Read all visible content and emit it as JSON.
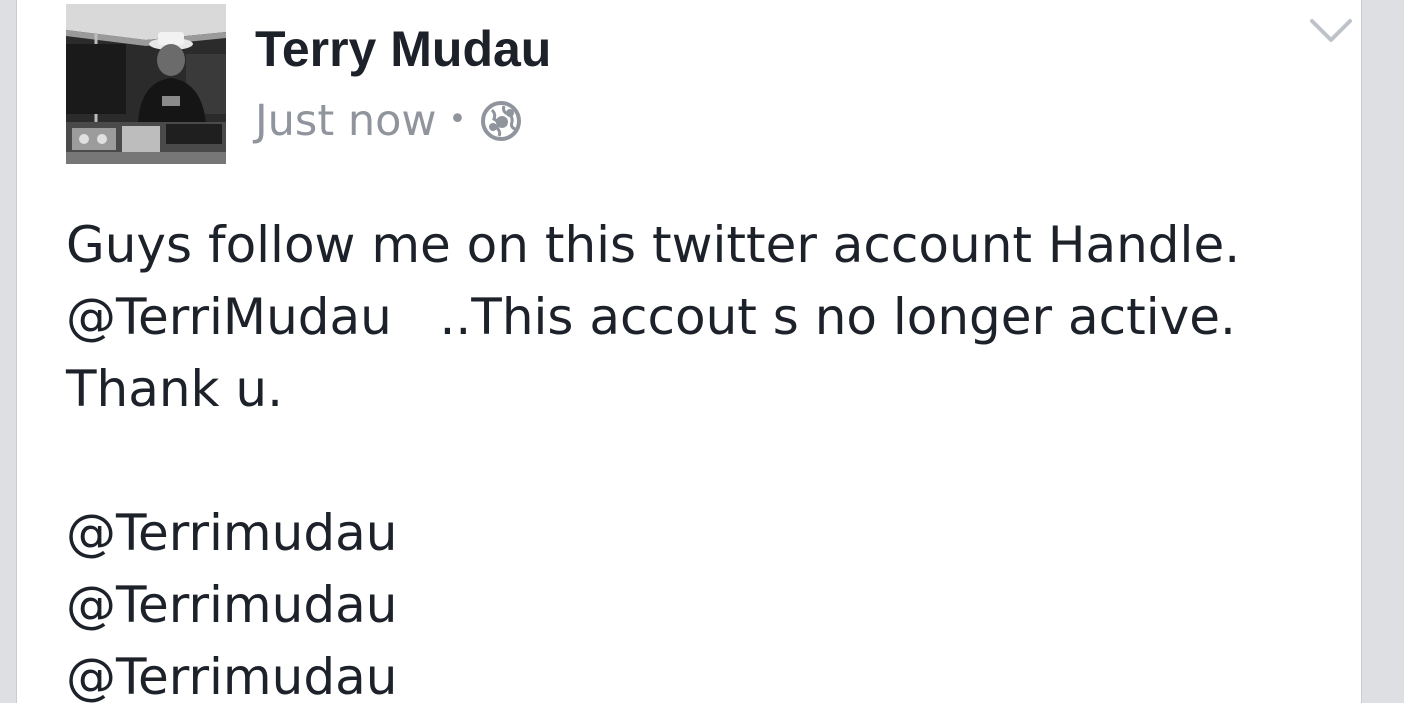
{
  "post": {
    "author": "Terry Mudau",
    "timestamp": "Just now",
    "separator": "•",
    "privacy_icon": "globe-icon",
    "menu_icon": "chevron-down-icon",
    "body_lines": [
      "Guys follow me on this twitter account Handle.",
      "@TerriMudau   ..This accout s no longer active.",
      "Thank u.",
      "",
      "@Terrimudau",
      "@Terrimudau",
      "@Terrimudau"
    ]
  },
  "colors": {
    "background": "#dddfe2",
    "card": "#ffffff",
    "text_primary": "#1d2129",
    "text_secondary": "#90949c"
  }
}
